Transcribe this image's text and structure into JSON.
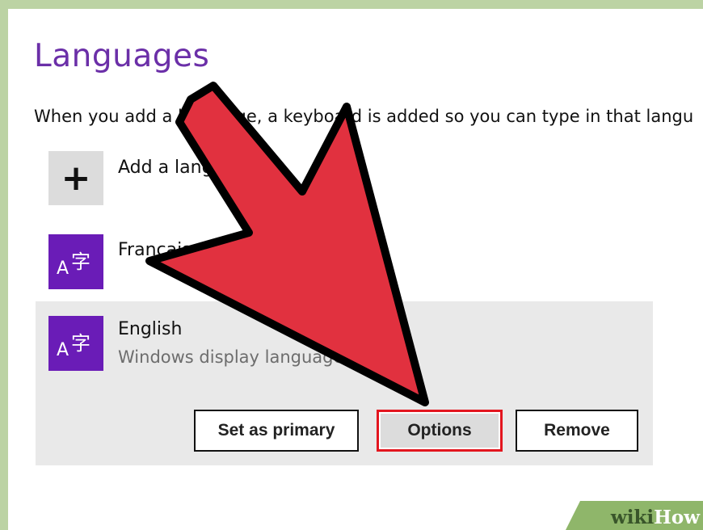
{
  "page": {
    "title": "Languages",
    "description": "When you add a language, a keyboard is added so you can type in that langu"
  },
  "add_language": {
    "icon": "plus-icon",
    "label": "Add a language"
  },
  "languages": [
    {
      "icon": "language-icon",
      "glyph_a": "A",
      "glyph_zi": "字",
      "name": "Français"
    },
    {
      "icon": "language-icon",
      "glyph_a": "A",
      "glyph_zi": "字",
      "name": "English",
      "subtitle": "Windows display language"
    }
  ],
  "buttons": {
    "set_primary": "Set as primary",
    "options": "Options",
    "remove": "Remove"
  },
  "annotation": {
    "arrow_color": "#e1313f",
    "highlight_color": "#e3161f"
  },
  "watermark": {
    "prefix": "wiki",
    "suffix": "How"
  },
  "colors": {
    "accent": "#6b2fa8",
    "tile": "#6a1cb7",
    "selected_bg": "#e9e9e9",
    "frame_border": "#bcd3a4"
  }
}
